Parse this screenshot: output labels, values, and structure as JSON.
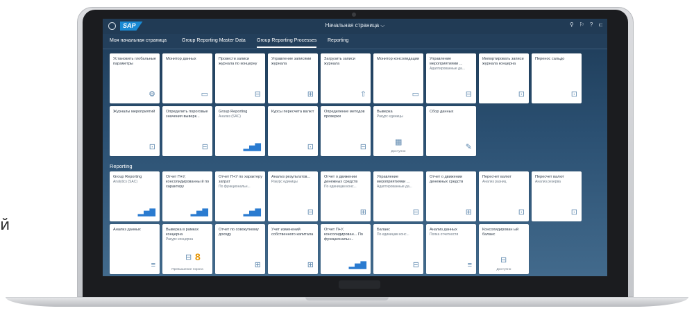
{
  "side_letter": "й",
  "shell": {
    "logo": "SAP",
    "title": "Начальная страница ⌵",
    "icons": [
      "search-icon",
      "notifications-icon",
      "help-icon",
      "menu-icon"
    ],
    "icon_glyphs": [
      "⚲",
      "⚐",
      "?",
      "⊏"
    ]
  },
  "tabs": [
    {
      "label": "Моя начальная страница"
    },
    {
      "label": "Group Reporting Master Data"
    },
    {
      "label": "Group Reporting Processes"
    },
    {
      "label": "Reporting"
    }
  ],
  "section": {
    "reporting": "Reporting"
  },
  "processes": [
    {
      "title": "Установить глобальные параметры",
      "sub": "",
      "icon": "⚙"
    },
    {
      "title": "Монитор данных",
      "sub": "",
      "icon": "▭"
    },
    {
      "title": "Провести записи журнала по концерну",
      "sub": "",
      "icon": "⊟"
    },
    {
      "title": "Управление записями журнала",
      "sub": "",
      "icon": "⊞"
    },
    {
      "title": "Загрузить записи журнала",
      "sub": "",
      "icon": "⇧"
    },
    {
      "title": "Монитор консолидации",
      "sub": "",
      "icon": "▭"
    },
    {
      "title": "Управление мероприятиями ...",
      "sub": "Адаптированные да...",
      "icon": "⊟"
    },
    {
      "title": "Импортировать записи журнала концерна",
      "sub": "",
      "icon": "⊡"
    },
    {
      "title": "Перенос сальдо",
      "sub": "",
      "icon": "⊡"
    },
    {
      "title": "Журналы мероприятий",
      "sub": "",
      "icon": "⊡"
    },
    {
      "title": "Определить пороговые значения выверк...",
      "sub": "",
      "icon": "⊟"
    },
    {
      "title": "Group Reporting",
      "sub": "Анализ (SAC)",
      "icon": "▂▅▇"
    },
    {
      "title": "Курсы пересчета валют",
      "sub": "",
      "icon": "⊡"
    },
    {
      "title": "Определение методов проверки",
      "sub": "",
      "icon": "⊟"
    },
    {
      "title": "Выверка",
      "sub": "Ракурс единицы",
      "icon": "▦",
      "foot": "Доступно"
    },
    {
      "title": "Сбор данных",
      "sub": "",
      "icon": "✎"
    }
  ],
  "reporting": [
    {
      "title": "Group Reporting",
      "sub": "Analytics (SAC)",
      "icon": "▂▅▇"
    },
    {
      "title": "Отчет П+У, консолидированны й по характеру",
      "sub": "",
      "icon": "▂▅▇"
    },
    {
      "title": "Отчет П+У по характеру затрат",
      "sub": "По функциональн...",
      "icon": "▂▅▇"
    },
    {
      "title": "Анализ результатов...",
      "sub": "Ракурс единицы",
      "icon": "⊟"
    },
    {
      "title": "Отчет о движении денежных средств",
      "sub": "По единицам конс...",
      "icon": "⊞"
    },
    {
      "title": "Управление мероприятиями ...",
      "sub": "Адаптированные да...",
      "icon": "⊟"
    },
    {
      "title": "Отчет о движении денежных средств",
      "sub": "",
      "icon": "⊞"
    },
    {
      "title": "Пересчет валют",
      "sub": "Анализ разниц",
      "icon": "⊡"
    },
    {
      "title": "Пересчет валют",
      "sub": "Анализ резерва",
      "icon": "⊡"
    },
    {
      "title": "Анализ данных",
      "sub": "",
      "icon": "≡"
    },
    {
      "title": "Выверка в рамках концерна",
      "sub": "Ракурс концерна",
      "icon": "⊟",
      "number": "8",
      "foot": "Превышение порога"
    },
    {
      "title": "Отчет по совокупному доходу",
      "sub": "",
      "icon": "⊞"
    },
    {
      "title": "Учет изменений собственного капитала",
      "sub": "",
      "icon": "⊞"
    },
    {
      "title": "Отчет П+У, консолидирован... По функциональн...",
      "sub": "",
      "icon": "▂▅▇"
    },
    {
      "title": "Баланс",
      "sub": "По единицам конс...",
      "icon": "⊟"
    },
    {
      "title": "Анализ данных",
      "sub": "Полка отчетности",
      "icon": "≡"
    },
    {
      "title": "Консолидирован ый баланс",
      "sub": "",
      "icon": "⊟",
      "foot": "Доступно"
    }
  ]
}
